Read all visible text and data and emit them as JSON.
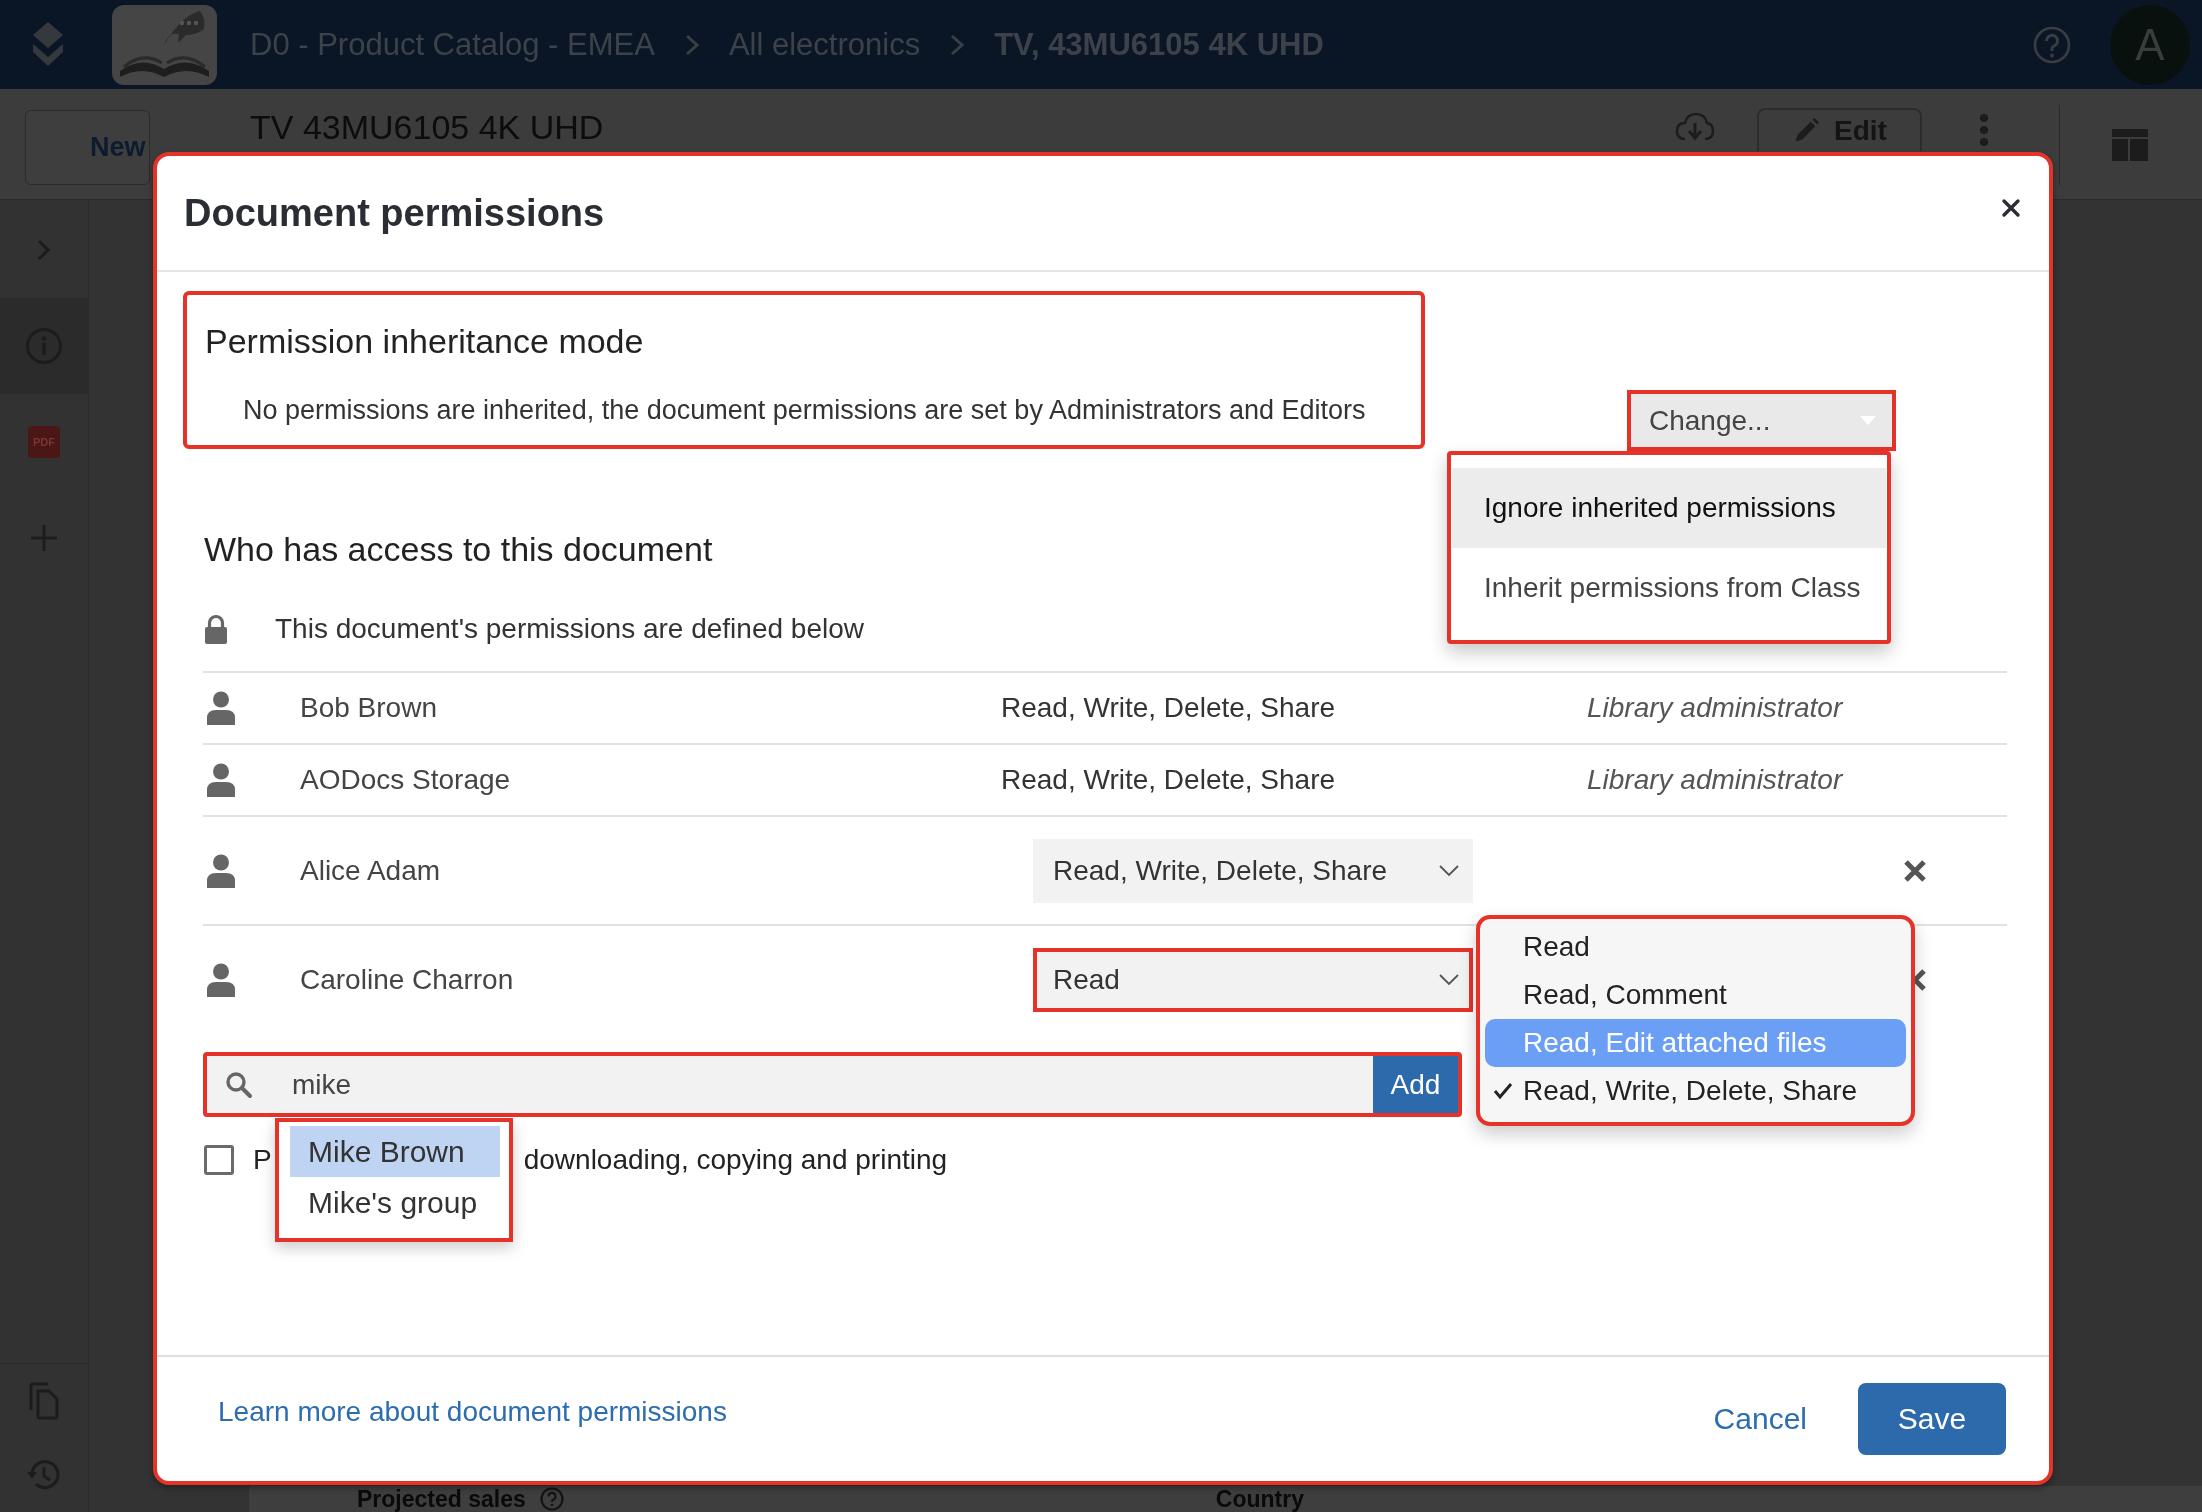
{
  "top_bar": {
    "breadcrumb": [
      {
        "label": "D0 - Product Catalog - EMEA",
        "current": false
      },
      {
        "label": "All electronics",
        "current": false
      },
      {
        "label": "TV, 43MU6105 4K UHD",
        "current": true
      }
    ],
    "avatar_initial": "A"
  },
  "toolbar": {
    "new_button": "New",
    "document_title": "TV 43MU6105 4K UHD",
    "edit_button": "Edit"
  },
  "sidebar": {
    "top_items": [
      {
        "kind": "expand",
        "selected": false
      },
      {
        "kind": "info",
        "selected": true
      },
      {
        "kind": "pdf",
        "label": "PDF",
        "selected": false
      },
      {
        "kind": "add",
        "selected": false
      }
    ],
    "bottom_items": [
      {
        "kind": "copy",
        "selected": false
      },
      {
        "kind": "history",
        "selected": false
      }
    ]
  },
  "dialog": {
    "title": "Document permissions",
    "inheritance": {
      "heading": "Permission inheritance mode",
      "description": "No permissions are inherited, the document permissions are set by Administrators and Editors",
      "change_button": "Change...",
      "menu": [
        {
          "label": "Ignore inherited permissions",
          "selected": true
        },
        {
          "label": "Inherit permissions from Class",
          "selected": false
        }
      ]
    },
    "access": {
      "heading": "Who has access to this document",
      "note": "This document's permissions are defined below",
      "rows": [
        {
          "kind": "fixed",
          "name": "Bob Brown",
          "permission": "Read, Write, Delete, Share",
          "role": "Library administrator",
          "highlighted": false
        },
        {
          "kind": "fixed",
          "name": "AODocs Storage",
          "permission": "Read, Write, Delete, Share",
          "role": "Library administrator",
          "highlighted": false
        },
        {
          "kind": "editable",
          "name": "Alice Adam",
          "permission": "Read, Write, Delete, Share",
          "highlighted": false
        },
        {
          "kind": "editable",
          "name": "Caroline Charron",
          "permission": "Read",
          "highlighted": true
        }
      ],
      "permission_menu": [
        {
          "label": "Read",
          "checked": false,
          "selected": false
        },
        {
          "label": "Read, Comment",
          "checked": false,
          "selected": false
        },
        {
          "label": "Read, Edit attached files",
          "checked": false,
          "selected": true
        },
        {
          "label": "Read, Write, Delete, Share",
          "checked": true,
          "selected": false
        }
      ]
    },
    "search": {
      "value": "mike",
      "add_button": "Add",
      "suggestions": [
        {
          "label": "Mike Brown",
          "selected": true
        },
        {
          "label": "Mike's group",
          "selected": false
        }
      ]
    },
    "protect_option": {
      "checked": false,
      "label_start": "P",
      "label_end": "downloading, copying and printing"
    },
    "learn_more_link": "Learn more about document permissions",
    "cancel_button": "Cancel",
    "save_button": "Save"
  },
  "background_table": {
    "columns": [
      "Projected sales",
      "Country"
    ]
  }
}
